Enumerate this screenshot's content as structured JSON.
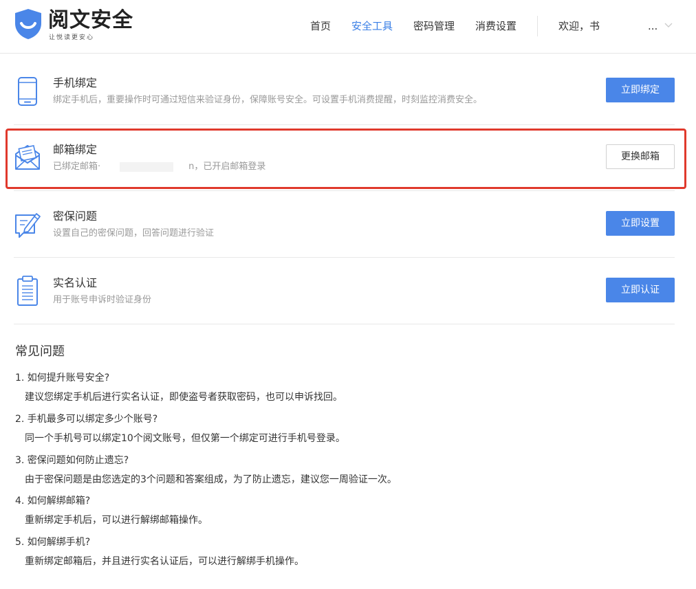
{
  "brand": {
    "name": "阅文安全",
    "slogan": "让悦读更安心",
    "color": "#3a7fe6"
  },
  "nav": {
    "items": [
      {
        "label": "首页",
        "active": false
      },
      {
        "label": "安全工具",
        "active": true
      },
      {
        "label": "密码管理",
        "active": false
      },
      {
        "label": "消费设置",
        "active": false
      }
    ],
    "user": "欢迎，书",
    "more": "..."
  },
  "security": {
    "phone": {
      "title": "手机绑定",
      "desc": "绑定手机后，重要操作时可通过短信来验证身份，保障账号安全。可设置手机消费提醒，时刻监控消费安全。",
      "button": "立即绑定"
    },
    "email": {
      "title": "邮箱绑定",
      "desc_prefix": "已绑定邮箱·",
      "desc_suffix": "n，已开启邮箱登录",
      "button": "更换邮箱"
    },
    "question": {
      "title": "密保问题",
      "desc": "设置自己的密保问题，回答问题进行验证",
      "button": "立即设置"
    },
    "realname": {
      "title": "实名认证",
      "desc": "用于账号申诉时验证身份",
      "button": "立即认证"
    }
  },
  "faq": {
    "title": "常见问题",
    "items": [
      {
        "q": "1. 如何提升账号安全?",
        "a": "建议您绑定手机后进行实名认证，即使盗号者获取密码，也可以申诉找回。"
      },
      {
        "q": "2. 手机最多可以绑定多少个账号?",
        "a": "同一个手机号可以绑定10个阅文账号，但仅第一个绑定可进行手机号登录。"
      },
      {
        "q": "3. 密保问题如何防止遗忘?",
        "a": "由于密保问题是由您选定的3个问题和答案组成，为了防止遗忘，建议您一周验证一次。"
      },
      {
        "q": "4. 如何解绑邮箱?",
        "a": "重新绑定手机后，可以进行解绑邮箱操作。"
      },
      {
        "q": "5. 如何解绑手机?",
        "a": "重新绑定邮箱后，并且进行实名认证后，可以进行解绑手机操作。"
      }
    ]
  },
  "colors": {
    "primary_button": "#4a86e8",
    "highlight_border": "#e0392c",
    "muted_text": "#999999"
  }
}
